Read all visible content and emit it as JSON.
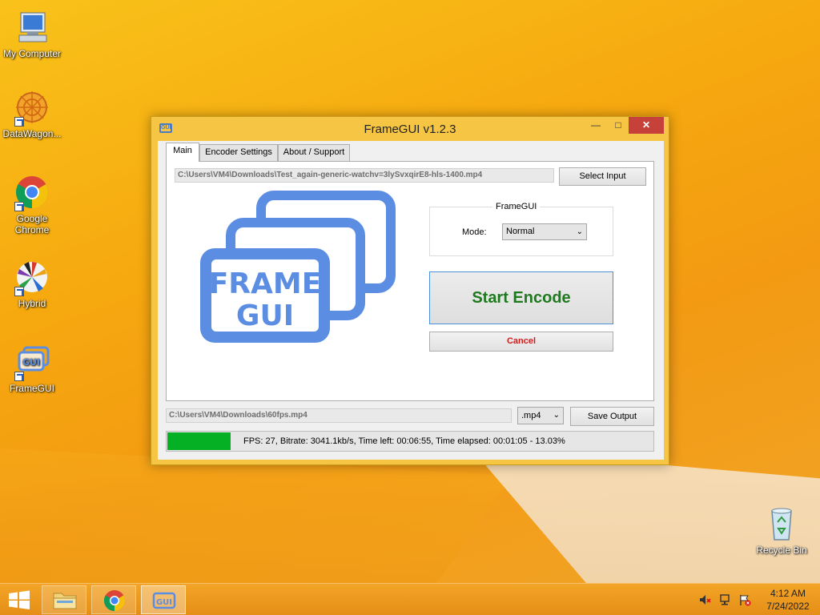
{
  "desktop": {
    "icons": [
      {
        "label": "My Computer"
      },
      {
        "label": "DataWagon..."
      },
      {
        "label": "Google Chrome"
      },
      {
        "label": "Hybrid"
      },
      {
        "label": "FrameGUI"
      },
      {
        "label": "Recycle Bin"
      }
    ]
  },
  "window": {
    "title": "FrameGUI v1.2.3",
    "icon_text": "GUI",
    "tabs": [
      {
        "label": "Main"
      },
      {
        "label": "Encoder Settings"
      },
      {
        "label": "About / Support"
      }
    ],
    "input_path": "C:\\Users\\VM4\\Downloads\\Test_again-generic-watchv=3lySvxqirE8-hls-1400.mp4",
    "select_input_label": "Select Input",
    "logo_line1": "FRAME",
    "logo_line2": "GUI",
    "group_title": "FrameGUI",
    "mode_label": "Mode:",
    "mode_value": "Normal",
    "start_label": "Start Encode",
    "cancel_label": "Cancel",
    "output_path": "C:\\Users\\VM4\\Downloads\\60fps.mp4",
    "format_value": ".mp4",
    "save_output_label": "Save Output",
    "progress_fraction": 0.1303,
    "status_text": "FPS: 27, Bitrate: 3041.1kb/s, Time left: 00:06:55, Time elapsed: 00:01:05 - 13.03%"
  },
  "taskbar": {
    "time": "4:12 AM",
    "date": "7/24/2022"
  },
  "colors": {
    "accent_blue": "#5b8de3",
    "start_text": "#1f7a1f",
    "cancel_text": "#d11a1a",
    "progress_fill": "#06b025"
  }
}
